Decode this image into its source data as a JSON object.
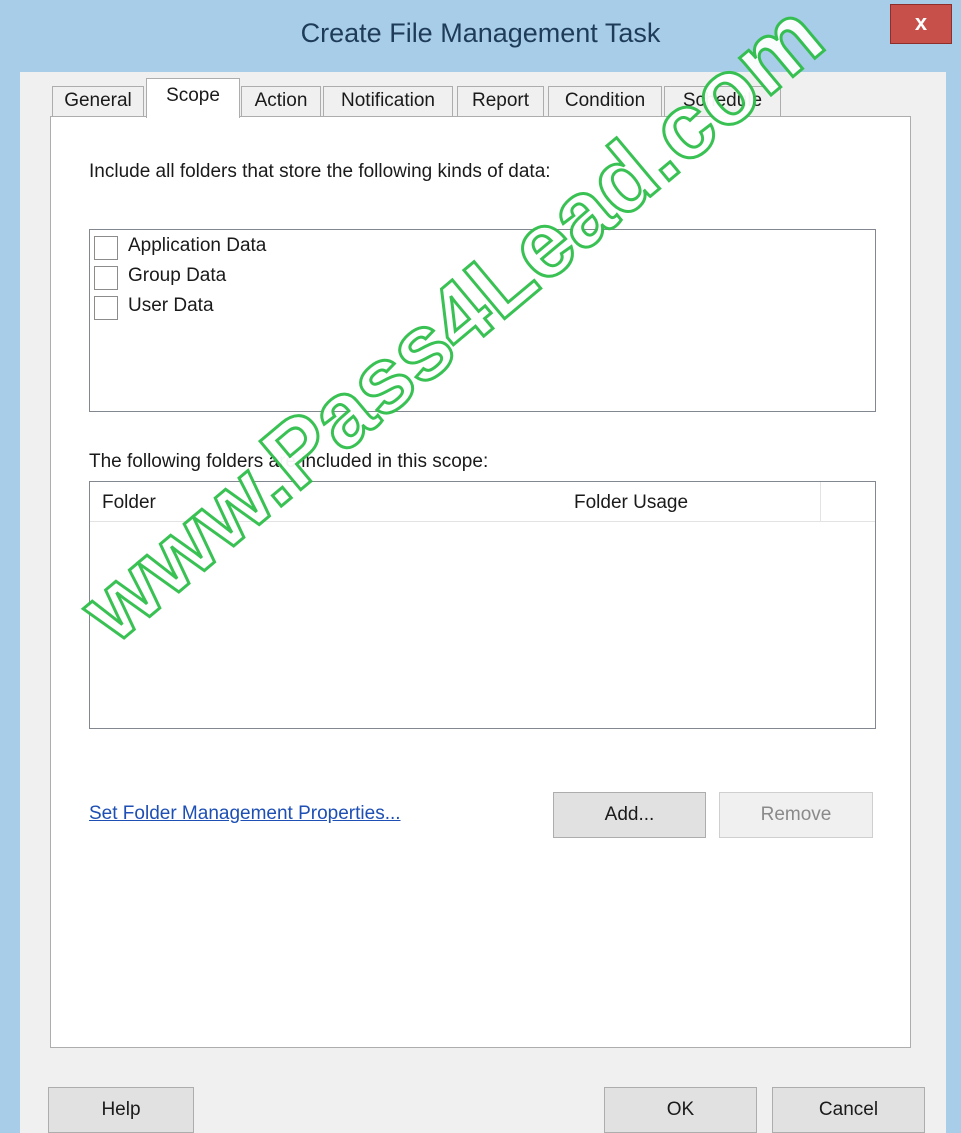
{
  "window": {
    "title": "Create File Management Task",
    "close_glyph": "x"
  },
  "tabs": [
    {
      "label": "General",
      "active": false
    },
    {
      "label": "Scope",
      "active": true
    },
    {
      "label": "Action",
      "active": false
    },
    {
      "label": "Notification",
      "active": false
    },
    {
      "label": "Report",
      "active": false
    },
    {
      "label": "Condition",
      "active": false
    },
    {
      "label": "Schedule",
      "active": false
    }
  ],
  "scope": {
    "include_label": "Include all folders that store the following kinds of data:",
    "data_kinds": [
      {
        "label": "Application Data",
        "checked": false
      },
      {
        "label": "Group Data",
        "checked": false
      },
      {
        "label": "User Data",
        "checked": false
      }
    ],
    "folders_label": "The following folders are included in this scope:",
    "folder_list": {
      "columns": [
        "Folder",
        "Folder Usage"
      ],
      "rows": []
    },
    "set_properties_link": "Set Folder Management Properties...",
    "add_button": "Add...",
    "remove_button": "Remove"
  },
  "footer": {
    "help_button": "Help",
    "ok_button": "OK",
    "cancel_button": "Cancel"
  },
  "watermark": "www.Pass4Lead.com",
  "colors": {
    "title_bar": "#a8cde8",
    "close_button": "#c7504a",
    "link": "#1e4fb4",
    "watermark_outline": "#2fbf4a"
  }
}
